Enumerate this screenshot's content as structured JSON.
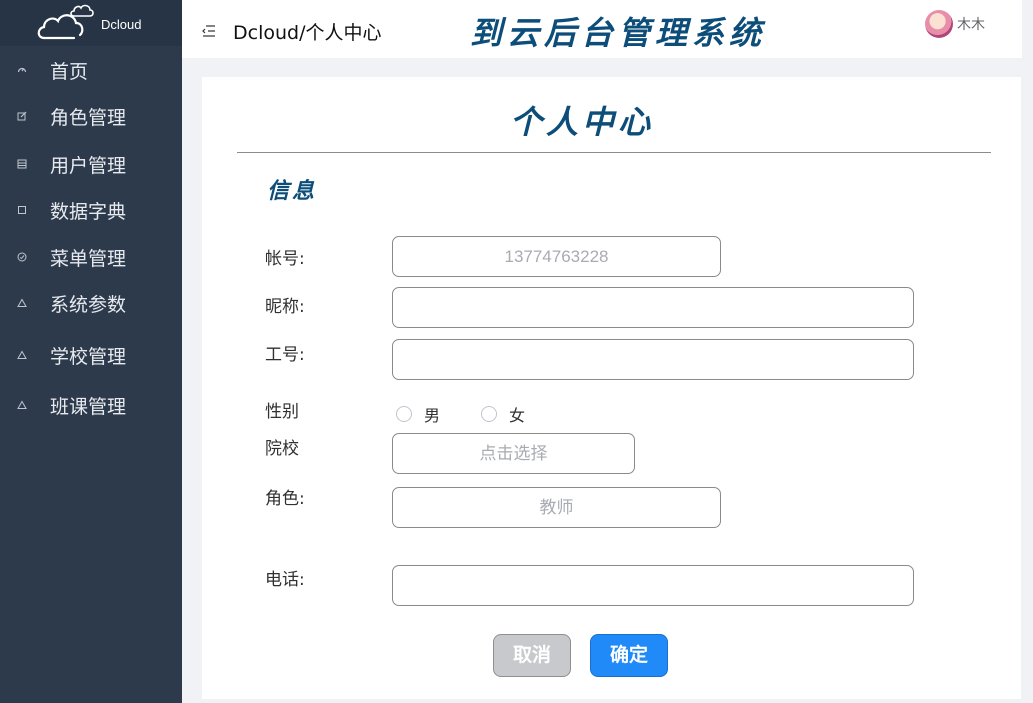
{
  "sidebar": {
    "logo_text": "Dcloud",
    "items": [
      {
        "label": "首页",
        "icon": "dashboard-icon"
      },
      {
        "label": "角色管理",
        "icon": "edit-icon"
      },
      {
        "label": "用户管理",
        "icon": "grid-icon"
      },
      {
        "label": "数据字典",
        "icon": "square-icon"
      },
      {
        "label": "菜单管理",
        "icon": "circle-check-icon"
      },
      {
        "label": "系统参数",
        "icon": "triangle-icon"
      },
      {
        "label": "学校管理",
        "icon": "triangle-icon"
      },
      {
        "label": "班课管理",
        "icon": "triangle-icon"
      }
    ]
  },
  "header": {
    "breadcrumb": "Dcloud/个人中心",
    "system_title": "到云后台管理系统",
    "username": "木木"
  },
  "card": {
    "title": "个人中心",
    "section_title": "信息",
    "fields": {
      "account": {
        "label": "帐号:",
        "value": "13774763228"
      },
      "nickname": {
        "label": "昵称:",
        "value": ""
      },
      "employee_id": {
        "label": "工号:",
        "value": ""
      },
      "gender": {
        "label": "性别",
        "options": [
          "男",
          "女"
        ],
        "selected": null
      },
      "school": {
        "label": "院校",
        "placeholder": "点击选择"
      },
      "role": {
        "label": "角色:",
        "value": "教师"
      },
      "phone": {
        "label": "电话:",
        "value": ""
      }
    },
    "buttons": {
      "cancel": "取消",
      "confirm": "确定"
    }
  },
  "colors": {
    "sidebar_bg": "#2d3a4b",
    "title_color": "#0d4d7a",
    "primary": "#1f8af8",
    "cancel_bg": "#c8c9cc"
  }
}
